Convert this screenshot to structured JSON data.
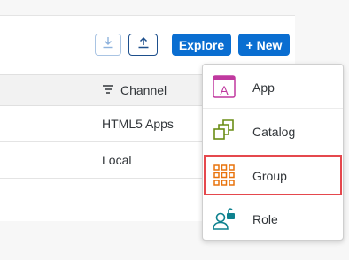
{
  "toolbar": {
    "explore_label": "Explore",
    "new_label": "+ New",
    "download_icon": "download-icon",
    "upload_icon": "upload-icon"
  },
  "table": {
    "channel_header": "Channel",
    "rows": [
      {
        "channel": "HTML5 Apps"
      },
      {
        "channel": "Local"
      }
    ]
  },
  "new_menu": {
    "items": [
      {
        "label": "App",
        "icon": "app-icon",
        "color": "#c0399f"
      },
      {
        "label": "Catalog",
        "icon": "catalog-icon",
        "color": "#6a8d15"
      },
      {
        "label": "Group",
        "icon": "group-icon",
        "color": "#e9730c"
      },
      {
        "label": "Role",
        "icon": "role-icon",
        "color": "#0f828f"
      }
    ]
  },
  "colors": {
    "primary": "#0a6ed1",
    "highlight_border": "#e5484d"
  }
}
